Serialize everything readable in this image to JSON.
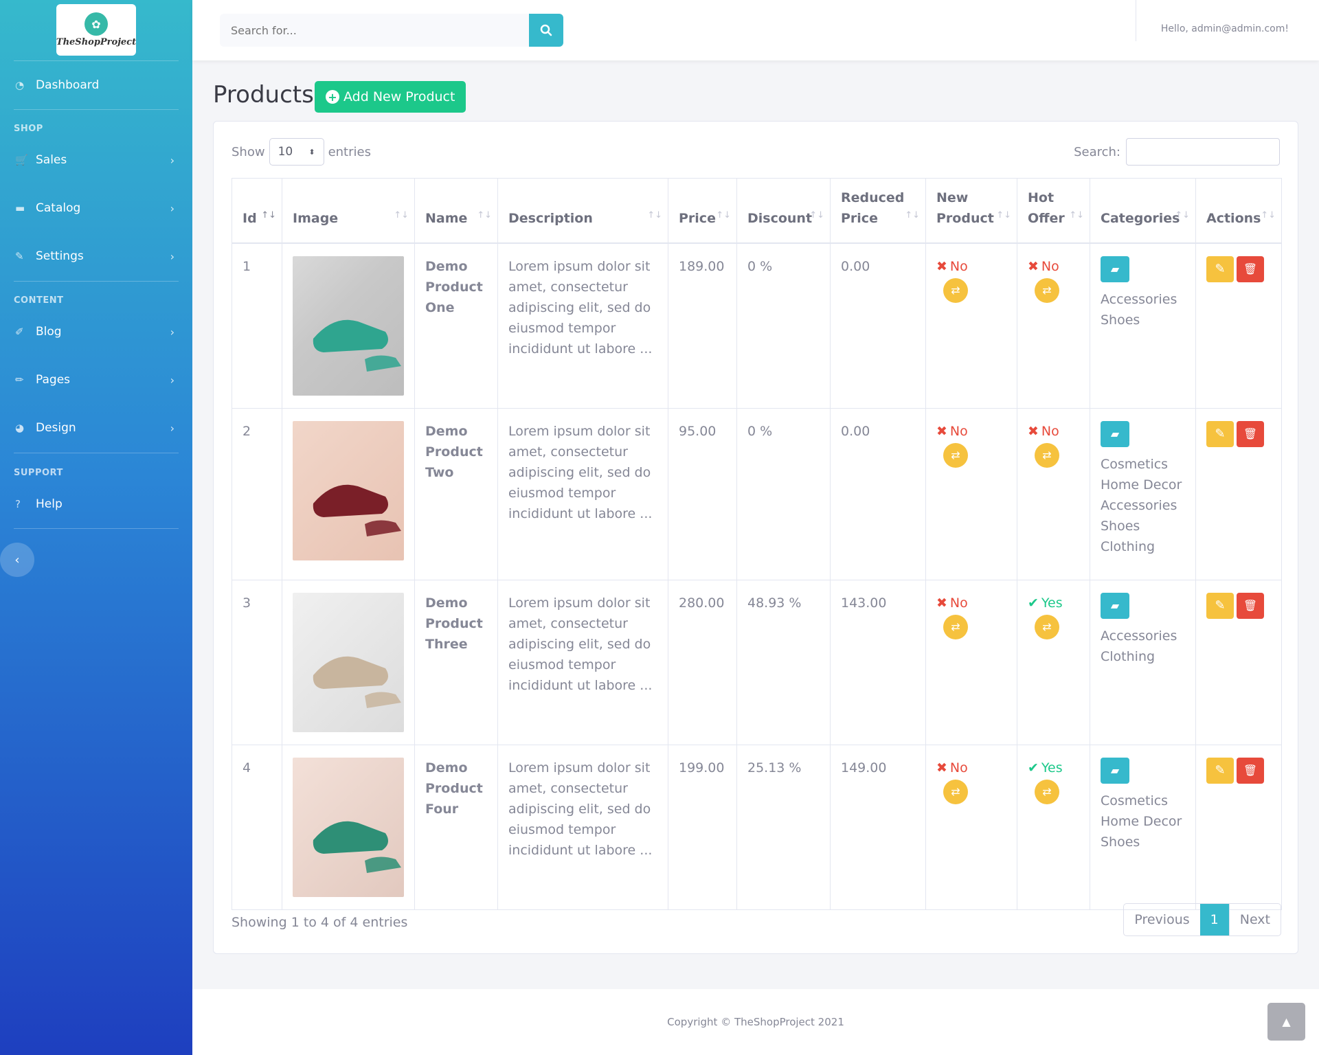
{
  "brand": {
    "logo_text": "TheShopProject"
  },
  "sidebar": {
    "dashboard": "Dashboard",
    "sections": {
      "shop": "SHOP",
      "content": "CONTENT",
      "support": "SUPPORT"
    },
    "items": [
      {
        "label": "Sales",
        "icon": "cart-icon"
      },
      {
        "label": "Catalog",
        "icon": "folder-icon"
      },
      {
        "label": "Settings",
        "icon": "wrench-icon"
      },
      {
        "label": "Blog",
        "icon": "blog-icon"
      },
      {
        "label": "Pages",
        "icon": "pencil-icon"
      },
      {
        "label": "Design",
        "icon": "palette-icon"
      },
      {
        "label": "Help",
        "icon": "question-circle-icon"
      }
    ]
  },
  "topbar": {
    "search_placeholder": "Search for...",
    "greeting": "Hello, admin@admin.com!"
  },
  "page": {
    "title": "Products",
    "add_button": "Add New Product"
  },
  "table_controls": {
    "show": "Show",
    "entries_value": "10",
    "entries": "entries",
    "search_label": "Search:"
  },
  "columns": [
    {
      "line1": "Id",
      "line2": ""
    },
    {
      "line1": "Image",
      "line2": ""
    },
    {
      "line1": "Name",
      "line2": ""
    },
    {
      "line1": "Description",
      "line2": ""
    },
    {
      "line1": "Price",
      "line2": ""
    },
    {
      "line1": "Discount",
      "line2": ""
    },
    {
      "line1": "Reduced",
      "line2": "Price"
    },
    {
      "line1": "New",
      "line2": "Product"
    },
    {
      "line1": "Hot",
      "line2": "Offer"
    },
    {
      "line1": "Categories",
      "line2": ""
    },
    {
      "line1": "Actions",
      "line2": ""
    }
  ],
  "rows": [
    {
      "id": "1",
      "name": [
        "Demo",
        "Product",
        "One"
      ],
      "description": [
        "Lorem ipsum dolor sit",
        "amet, consectetur",
        "adipiscing elit, sed do",
        "eiusmod tempor",
        "incididunt ut labore ..."
      ],
      "price": "189.00",
      "discount": "0 %",
      "reduced": "0.00",
      "new": "No",
      "hot": "No",
      "categories": [
        "Accessories",
        "Shoes"
      ]
    },
    {
      "id": "2",
      "name": [
        "Demo",
        "Product",
        "Two"
      ],
      "description": [
        "Lorem ipsum dolor sit",
        "amet, consectetur",
        "adipiscing elit, sed do",
        "eiusmod tempor",
        "incididunt ut labore ..."
      ],
      "price": "95.00",
      "discount": "0 %",
      "reduced": "0.00",
      "new": "No",
      "hot": "No",
      "categories": [
        "Cosmetics",
        "Home Decor",
        "Accessories",
        "Shoes",
        "Clothing"
      ]
    },
    {
      "id": "3",
      "name": [
        "Demo",
        "Product",
        "Three"
      ],
      "description": [
        "Lorem ipsum dolor sit",
        "amet, consectetur",
        "adipiscing elit, sed do",
        "eiusmod tempor",
        "incididunt ut labore ..."
      ],
      "price": "280.00",
      "discount": "48.93 %",
      "reduced": "143.00",
      "new": "No",
      "hot": "Yes",
      "categories": [
        "Accessories",
        "Clothing"
      ]
    },
    {
      "id": "4",
      "name": [
        "Demo",
        "Product",
        "Four"
      ],
      "description": [
        "Lorem ipsum dolor sit",
        "amet, consectetur",
        "adipiscing elit, sed do",
        "eiusmod tempor",
        "incididunt ut labore ..."
      ],
      "price": "199.00",
      "discount": "25.13 %",
      "reduced": "149.00",
      "new": "No",
      "hot": "Yes",
      "categories": [
        "Cosmetics",
        "Home Decor",
        "Shoes"
      ]
    }
  ],
  "footer_info": {
    "showing": "Showing 1 to 4 of 4 entries",
    "previous": "Previous",
    "current_page": "1",
    "next": "Next"
  },
  "footer": {
    "copyright": "Copyright © TheShopProject 2021"
  },
  "colors": {
    "accent": "#36b9cc",
    "success": "#1cc88a",
    "warning": "#f6c23e",
    "danger": "#e74a3b"
  }
}
